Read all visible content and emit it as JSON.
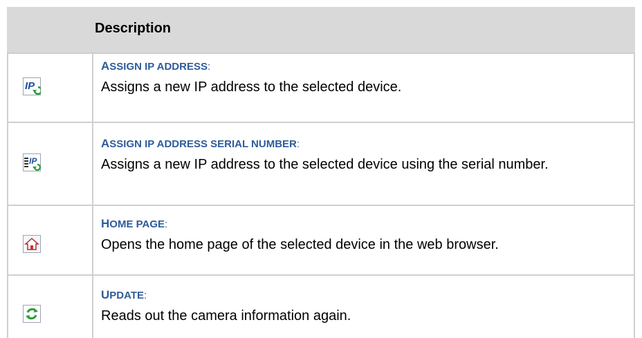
{
  "header": {
    "title": "Description"
  },
  "rows": [
    {
      "icon": "assign-ip-icon",
      "title_first": "A",
      "title_rest": "SSIGN IP ADDRESS",
      "title_colon": ":",
      "description": "Assigns a new IP address to the selected device."
    },
    {
      "icon": "assign-ip-serial-icon",
      "title_first": "A",
      "title_rest": "SSIGN IP ADDRESS SERIAL NUMBER",
      "title_colon": ":",
      "description": "Assigns a new IP address to the selected device using the serial number."
    },
    {
      "icon": "home-page-icon",
      "title_first": "H",
      "title_rest": "OME PAGE",
      "title_colon": ":",
      "description": "Opens the home page of the selected device in the web browser."
    },
    {
      "icon": "update-icon",
      "title_first": "U",
      "title_rest": "PDATE",
      "title_colon": ":",
      "description": "Reads out the camera information again."
    }
  ],
  "colors": {
    "header_bg": "#d9d9d9",
    "title": "#2e5b9a",
    "border": "#cfcfcf"
  }
}
